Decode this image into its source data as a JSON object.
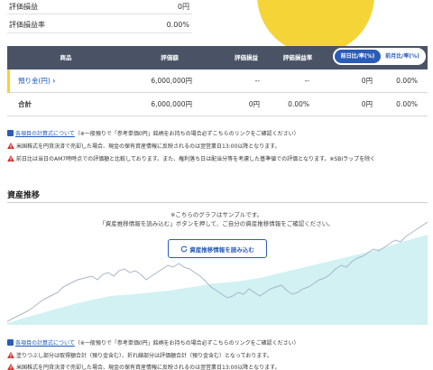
{
  "summary": {
    "rows": [
      {
        "label": "評価損益",
        "value": "0円"
      },
      {
        "label": "評価損益率",
        "value": "0.00%"
      }
    ]
  },
  "table": {
    "headers": {
      "product": "商品",
      "valuation": "評価額",
      "pl": "評価損益",
      "pl_rate": "評価損益率"
    },
    "toggle": {
      "active": "前日比/率(%)",
      "inactive": "前月比/率(%)"
    },
    "rows": {
      "deposit": {
        "name": "預り金(円)",
        "valuation": "6,000,000円",
        "pl": "--",
        "pl_rate": "--",
        "diff": "0円",
        "diff_rate": "0.00%"
      },
      "total": {
        "name": "合計",
        "valuation": "6,000,000円",
        "pl": "0円",
        "pl_rate": "0.00%",
        "diff": "0円",
        "diff_rate": "0.00%"
      }
    }
  },
  "notes": [
    {
      "link": "各項目の計算式について",
      "text": "（※一般預りで「参考単価0円」銘柄をお持ちの場合必ずこちらのリンクをご確認ください）"
    },
    {
      "text": "米国株式を円貨決済で売却した場合、現金の保有資産情報に反映されるのは翌営業日13:00以降となります。"
    },
    {
      "text": "前日比は当日のAM7時時点での評価額と比較しております。また、権利落ち日は配当分等を考慮した基準値での評価となります。※SBIラップを除く"
    }
  ],
  "asset_section": {
    "title": "資産推移",
    "sample_line1": "※こちらのグラフはサンプルです。",
    "sample_line2": "「資産推移情報を読み込む」ボタンを押して、ご自分の資産推移情報をご確認ください。",
    "load_button": "資産推移情報を読み込む"
  },
  "bottom_notes": [
    {
      "link": "各項目の計算式について",
      "text": "（※一般預りで「参考単価0円」銘柄をお持ちの場合必ずこちらのリンクをご確認ください）"
    },
    {
      "text": "塗りつぶし部分は取得額合計（預り金含む）、折れ線部分は評価額合計（預り金含む）となっております。"
    },
    {
      "text": "米国株式を円貨決済で売却した場合、現金の保有資産情報に反映されるのは翌営業日13:00以降となります。"
    }
  ],
  "colors": {
    "header_bg": "#4a5366",
    "accent_blue": "#2a5cb8",
    "sun_yellow": "#f4d437",
    "warn_red": "#d6302a",
    "chart_fill": "#c9eef0",
    "chart_line": "#a9b6c8"
  },
  "icons": {
    "warning": "warning-icon",
    "calculator": "calculator-icon",
    "reload": "reload-icon",
    "chevron": "chevron-right-icon"
  }
}
